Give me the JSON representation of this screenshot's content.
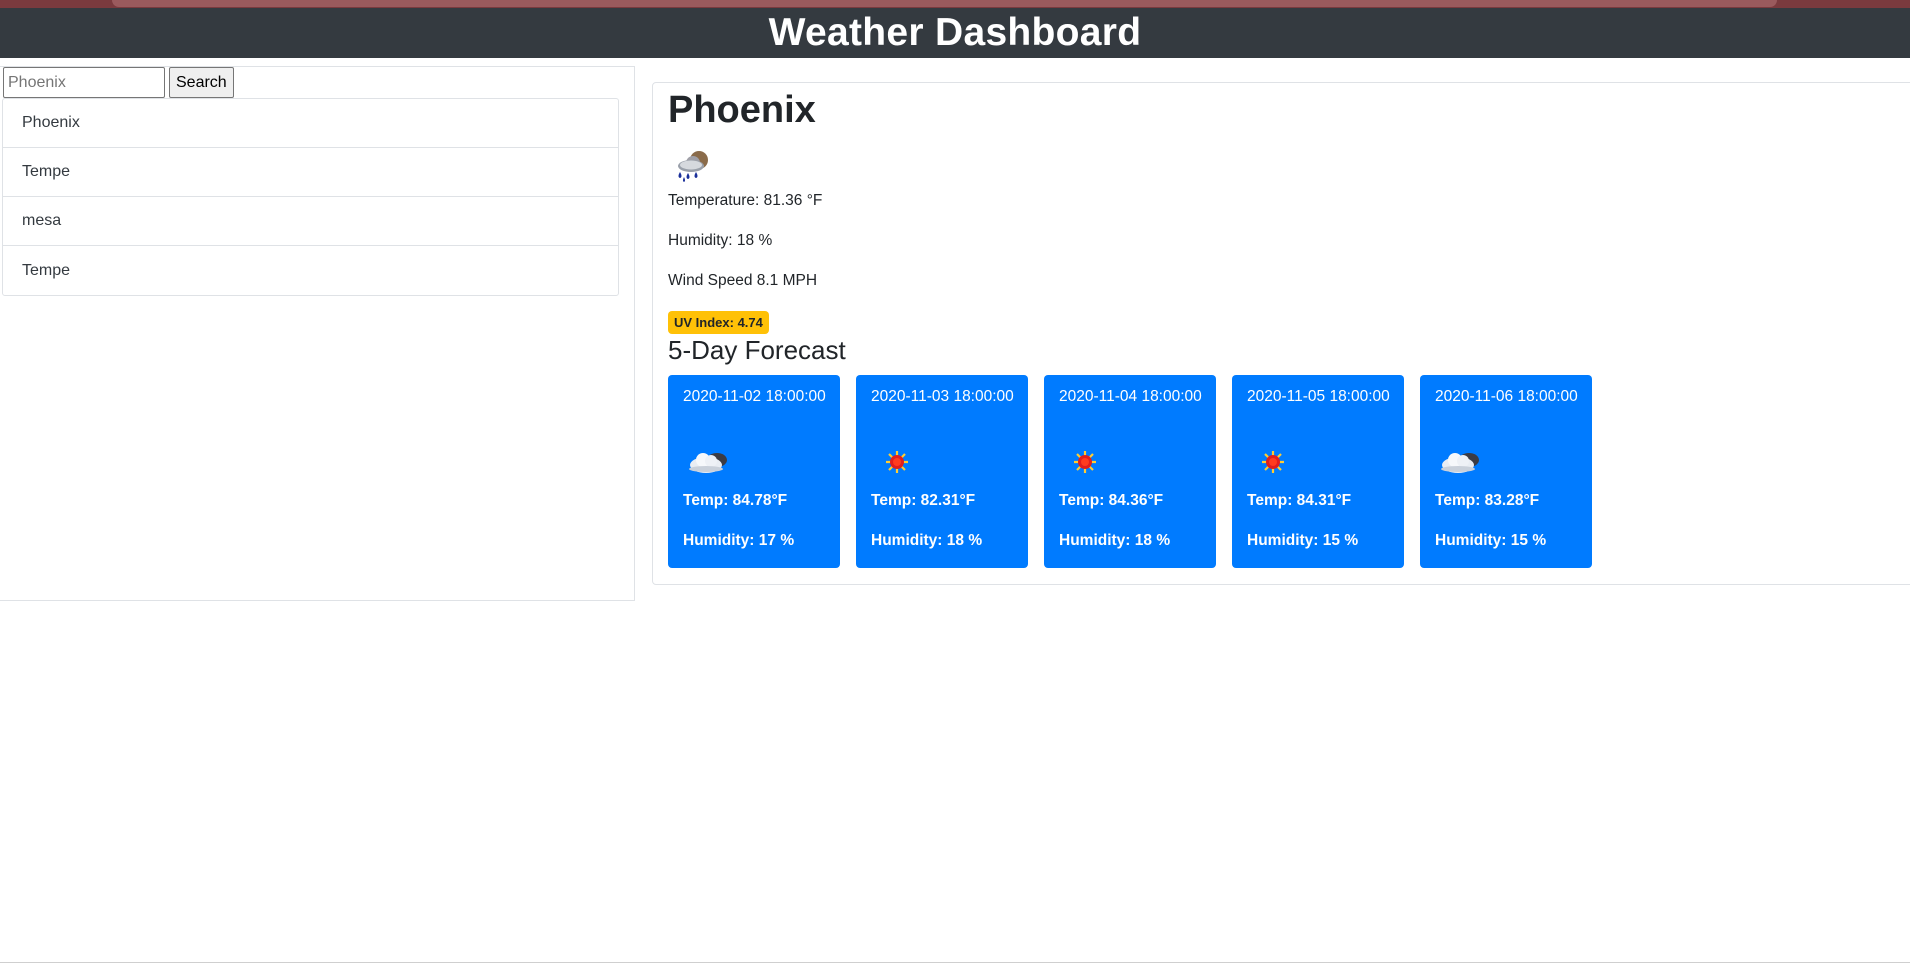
{
  "header": {
    "title": "Weather Dashboard"
  },
  "search": {
    "value": "Phoenix",
    "placeholder": "Phoenix",
    "button_label": "Search"
  },
  "history": [
    {
      "label": "Phoenix"
    },
    {
      "label": "Tempe"
    },
    {
      "label": "mesa"
    },
    {
      "label": "Tempe"
    }
  ],
  "current": {
    "city": "Phoenix",
    "icon": "rain-cloud-icon",
    "temperature": "Temperature: 81.36 °F",
    "humidity": "Humidity: 18 %",
    "wind": "Wind Speed 8.1 MPH",
    "uv": "UV Index: 4.74",
    "uv_color": "#ffc107"
  },
  "forecast_title": "5-Day Forecast",
  "forecast": [
    {
      "date": "2020-11-02 18:00:00",
      "icon": "cloud-icon",
      "temp": "Temp: 84.78°F",
      "humidity": "Humidity: 17 %"
    },
    {
      "date": "2020-11-03 18:00:00",
      "icon": "sun-icon",
      "temp": "Temp: 82.31°F",
      "humidity": "Humidity: 18 %"
    },
    {
      "date": "2020-11-04 18:00:00",
      "icon": "sun-icon",
      "temp": "Temp: 84.36°F",
      "humidity": "Humidity: 18 %"
    },
    {
      "date": "2020-11-05 18:00:00",
      "icon": "sun-icon",
      "temp": "Temp: 84.31°F",
      "humidity": "Humidity: 15 %"
    },
    {
      "date": "2020-11-06 18:00:00",
      "icon": "cloud-icon",
      "temp": "Temp: 83.28°F",
      "humidity": "Humidity: 15 %"
    }
  ],
  "colors": {
    "navbar": "#343a40",
    "forecast_card": "#007bff",
    "uv_badge": "#ffc107"
  }
}
